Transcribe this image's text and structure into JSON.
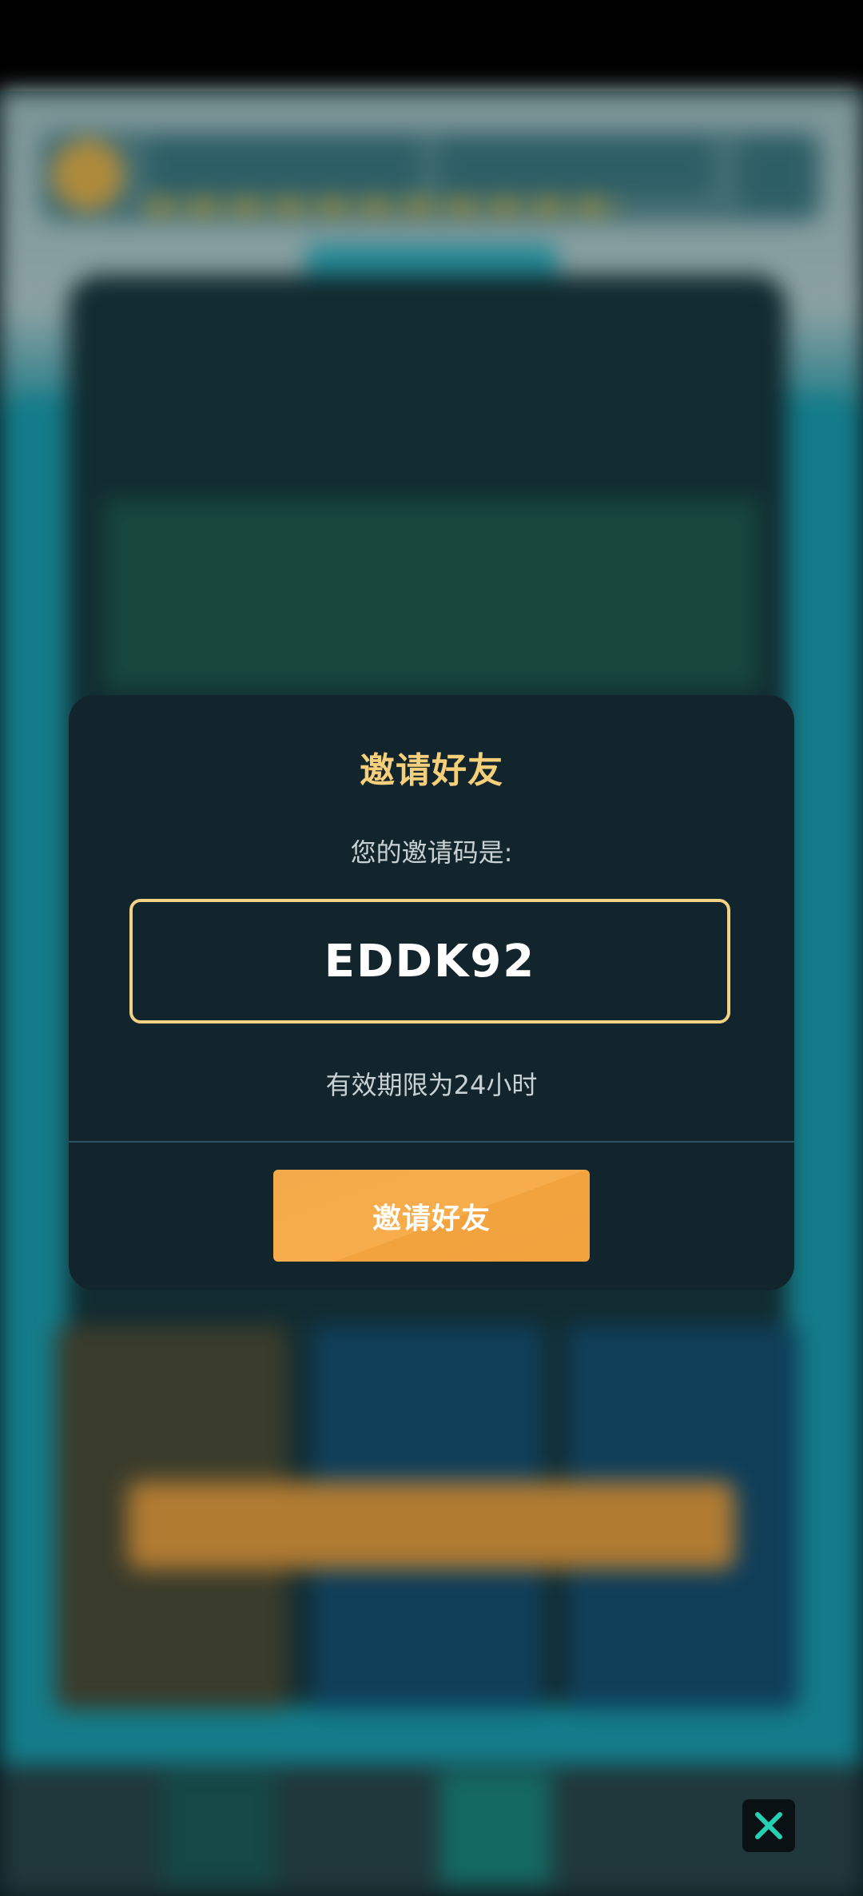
{
  "modal": {
    "title": "邀请好友",
    "subtitle": "您的邀请码是:",
    "code": "EDDK92",
    "validity": "有效期限为24小时",
    "button_label": "邀请好友"
  },
  "colors": {
    "title": "#f6cf7a",
    "code_border": "#f2d386",
    "button": "#f4aa4a",
    "modal_bg": "#13252c"
  },
  "icons": {
    "nav_close": "close-icon"
  }
}
